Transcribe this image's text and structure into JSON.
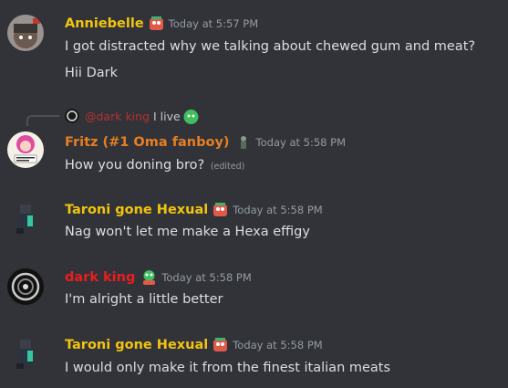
{
  "colors": {
    "background": "#313338",
    "yellow_role": "#f1c40f",
    "orange_role": "#e67e22",
    "red_role": "#e91e1e",
    "timestamp": "#949ba4",
    "text": "#dbdee1"
  },
  "messages": [
    {
      "username": "Anniebelle",
      "timestamp": "Today at 5:57 PM",
      "lines": [
        "I got distracted why we talking about chewed gum and meat?",
        "Hii Dark"
      ]
    },
    {
      "reply": {
        "mention": "@dark king",
        "text": "I live"
      },
      "username": "Fritz (#1 Oma fanboy)",
      "timestamp": "Today at 5:58 PM",
      "lines": [
        "How you doning bro?"
      ],
      "edited": "(edited)"
    },
    {
      "username": "Taroni gone Hexual",
      "timestamp": "Today at 5:58 PM",
      "lines": [
        "Nag won't let me make a Hexa effigy"
      ]
    },
    {
      "username": "dark king",
      "timestamp": "Today at 5:58 PM",
      "lines": [
        "I'm alright a little better"
      ]
    },
    {
      "username": "Taroni gone Hexual",
      "timestamp": "Today at 5:58 PM",
      "lines": [
        "I would only make it from the finest italian meats"
      ]
    }
  ]
}
